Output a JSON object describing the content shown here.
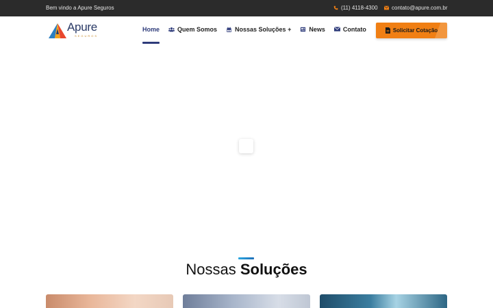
{
  "topbar": {
    "welcome": "Bem vindo a Apure Seguros",
    "phone": "(11) 4118-4300",
    "email": "contato@apure.com.br"
  },
  "brand": {
    "name": "Apure",
    "tagline": "SEGUROS"
  },
  "nav": {
    "items": [
      {
        "label": "Home",
        "icon": "home",
        "active": true
      },
      {
        "label": "Quem Somos",
        "icon": "users-icon"
      },
      {
        "label": "Nossas Soluções +",
        "icon": "gift-icon"
      },
      {
        "label": "News",
        "icon": "newspaper-icon"
      },
      {
        "label": "Contato",
        "icon": "envelope-icon"
      }
    ],
    "cta_label": "Solicitar Cotação"
  },
  "section": {
    "title_light": "Nossas ",
    "title_bold": "Soluções"
  },
  "colors": {
    "topbar_bg": "#2b2b2b",
    "accent_orange": "#f07f14",
    "nav_active": "#2e3b7a",
    "title_accent": "#2aa7e1"
  }
}
